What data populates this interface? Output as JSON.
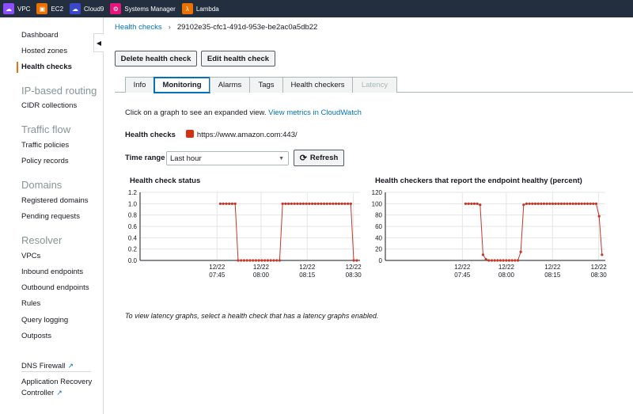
{
  "topbar": {
    "services": [
      {
        "label": "VPC",
        "icon": "vpc-icon",
        "color": "#8c4fff"
      },
      {
        "label": "EC2",
        "icon": "ec2-icon",
        "color": "#ed7100"
      },
      {
        "label": "Cloud9",
        "icon": "cloud9-icon",
        "color": "#3b48cc"
      },
      {
        "label": "Systems Manager",
        "icon": "systems-manager-icon",
        "color": "#e7157b"
      },
      {
        "label": "Lambda",
        "icon": "lambda-icon",
        "color": "#ed7100"
      }
    ]
  },
  "sidebar": {
    "items": {
      "dashboard": "Dashboard",
      "hosted_zones": "Hosted zones",
      "health_checks": "Health checks",
      "ip_routing": "IP-based routing",
      "cidr": "CIDR collections",
      "traffic_flow": "Traffic flow",
      "traffic_policies": "Traffic policies",
      "policy_records": "Policy records",
      "domains": "Domains",
      "registered_domains": "Registered domains",
      "pending_requests": "Pending requests",
      "resolver": "Resolver",
      "vpcs": "VPCs",
      "inbound": "Inbound endpoints",
      "outbound": "Outbound endpoints",
      "rules": "Rules",
      "query_logging": "Query logging",
      "outposts": "Outposts",
      "dns_firewall": "DNS Firewall",
      "arc_line1": "Application Recovery",
      "arc_line2": "Controller"
    }
  },
  "breadcrumb": {
    "parent": "Health checks",
    "current": "29102e35-cfc1-491d-953e-be2ac0a5db22"
  },
  "actions": {
    "delete": "Delete health check",
    "edit": "Edit health check"
  },
  "tabs": {
    "info": "Info",
    "monitoring": "Monitoring",
    "alarms": "Alarms",
    "tags": "Tags",
    "checkers": "Health checkers",
    "latency": "Latency"
  },
  "monitoring": {
    "intro": "Click on a graph to see an expanded view.",
    "intro_link": "View metrics in CloudWatch",
    "hc_label": "Health checks",
    "hc_url": "https://www.amazon.com:443/",
    "time_label": "Time range",
    "time_value": "Last hour",
    "refresh": "Refresh",
    "note": "To view latency graphs, select a health check that has a latency graphs enabled."
  },
  "chart_data": [
    {
      "type": "line",
      "title": "Health check status",
      "ylim": [
        0,
        1.2
      ],
      "yticks": [
        "1.2",
        "1.0",
        "0.8",
        "0.6",
        "0.4",
        "0.2",
        "0.0"
      ],
      "xticks": [
        {
          "date": "12/22",
          "time": "07:45"
        },
        {
          "date": "12/22",
          "time": "08:00"
        },
        {
          "date": "12/22",
          "time": "08:15"
        },
        {
          "date": "12/22",
          "time": "08:30"
        }
      ],
      "color": "#c0392b",
      "series": [
        {
          "values": [
            1,
            1,
            1,
            1,
            1,
            1,
            0,
            0,
            0,
            0,
            0,
            0,
            0,
            0,
            0,
            0,
            0,
            0,
            0,
            0,
            0,
            1,
            1,
            1,
            1,
            1,
            1,
            1,
            1,
            1,
            1,
            1,
            1,
            1,
            1,
            1,
            1,
            1,
            1,
            1,
            1,
            1,
            1,
            1,
            1,
            0,
            0
          ]
        }
      ]
    },
    {
      "type": "line",
      "title": "Health checkers that report the endpoint healthy (percent)",
      "ylim": [
        0,
        120
      ],
      "yticks": [
        "120",
        "100",
        "80",
        "60",
        "40",
        "20",
        "0"
      ],
      "xticks": [
        {
          "date": "12/22",
          "time": "07:45"
        },
        {
          "date": "12/22",
          "time": "08:00"
        },
        {
          "date": "12/22",
          "time": "08:15"
        },
        {
          "date": "12/22",
          "time": "08:30"
        }
      ],
      "color": "#c0392b",
      "series": [
        {
          "values": [
            100,
            100,
            100,
            100,
            100,
            98,
            10,
            2,
            0,
            0,
            0,
            0,
            0,
            0,
            0,
            0,
            0,
            0,
            0,
            15,
            98,
            100,
            100,
            100,
            100,
            100,
            100,
            100,
            100,
            100,
            100,
            100,
            100,
            100,
            100,
            100,
            100,
            100,
            100,
            100,
            100,
            100,
            100,
            100,
            100,
            100,
            78,
            10
          ]
        }
      ]
    }
  ]
}
